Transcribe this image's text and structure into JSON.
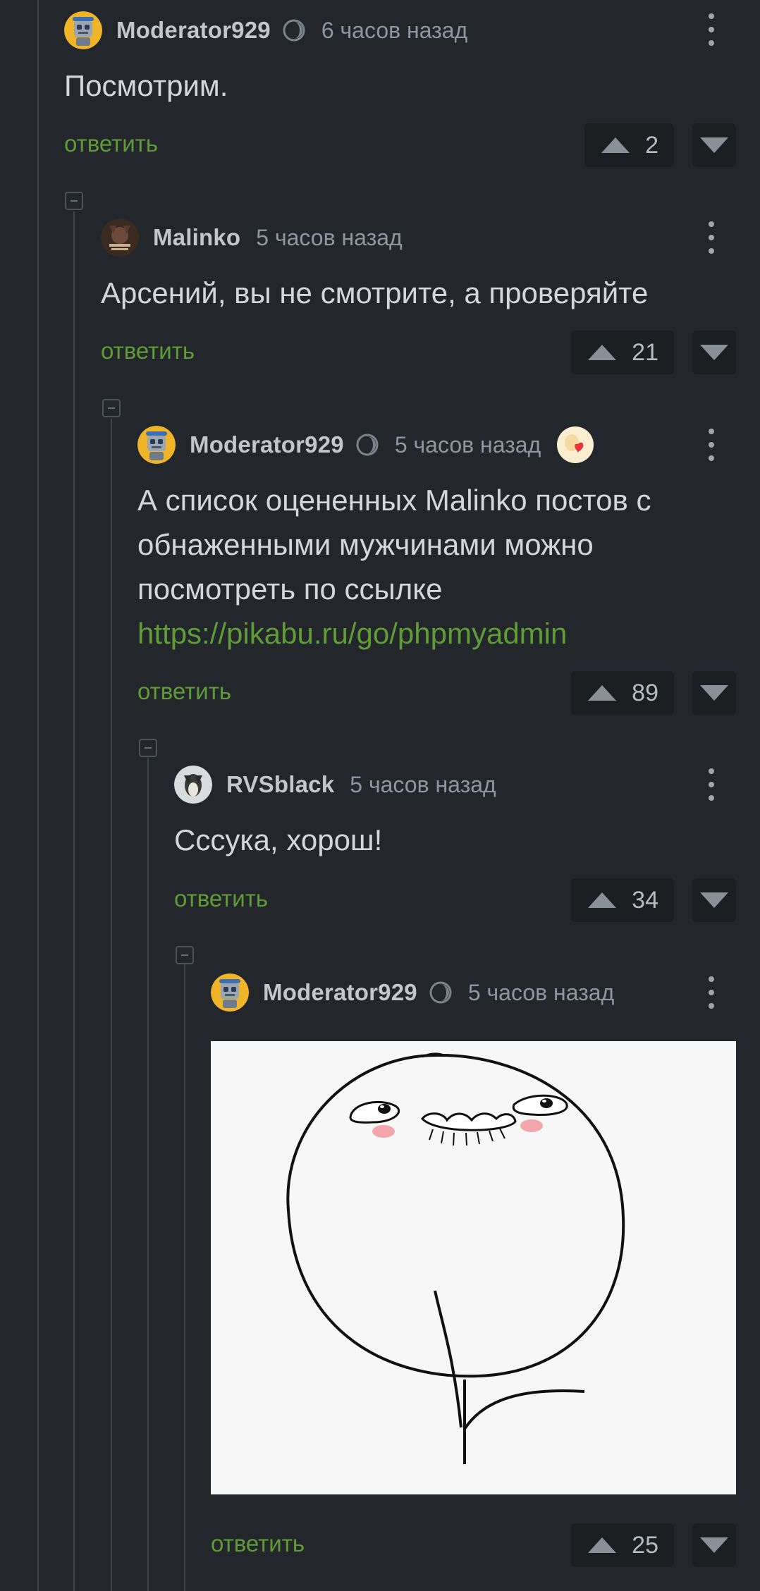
{
  "comments": [
    {
      "username": "Moderator929",
      "time": "6 часов назад",
      "text": "Посмотрим.",
      "reply_label": "ответить",
      "score": "2",
      "avatar_icon": "robot-avatar",
      "has_badge": true
    },
    {
      "username": "Malinko",
      "time": "5 часов назад",
      "text": "Арсений, вы не смотрите, а проверяйте",
      "reply_label": "ответить",
      "score": "21",
      "avatar_icon": "user-avatar",
      "has_badge": false
    },
    {
      "username": "Moderator929",
      "time": "5 часов назад",
      "text": "А список оцененных Malinko постов с обнаженными мужчинами можно посмотреть по ссылке",
      "link": "https://pikabu.ru/go/phpmyadmin",
      "reply_label": "ответить",
      "score": "89",
      "avatar_icon": "robot-avatar",
      "has_badge": true,
      "award_icon": "heart-award-icon"
    },
    {
      "username": "RVSblack",
      "time": "5 часов назад",
      "text": "Сссука, хорош!",
      "reply_label": "ответить",
      "score": "34",
      "avatar_icon": "user-avatar",
      "has_badge": false
    },
    {
      "username": "Moderator929",
      "time": "5 часов назад",
      "image": "rage-comic-face",
      "reply_label": "ответить",
      "score": "25",
      "avatar_icon": "robot-avatar",
      "has_badge": true
    }
  ],
  "colors": {
    "background": "#23272b",
    "accent_green": "#5f9b37",
    "vote_box": "#1c1f22",
    "text": "#d4d7da"
  }
}
